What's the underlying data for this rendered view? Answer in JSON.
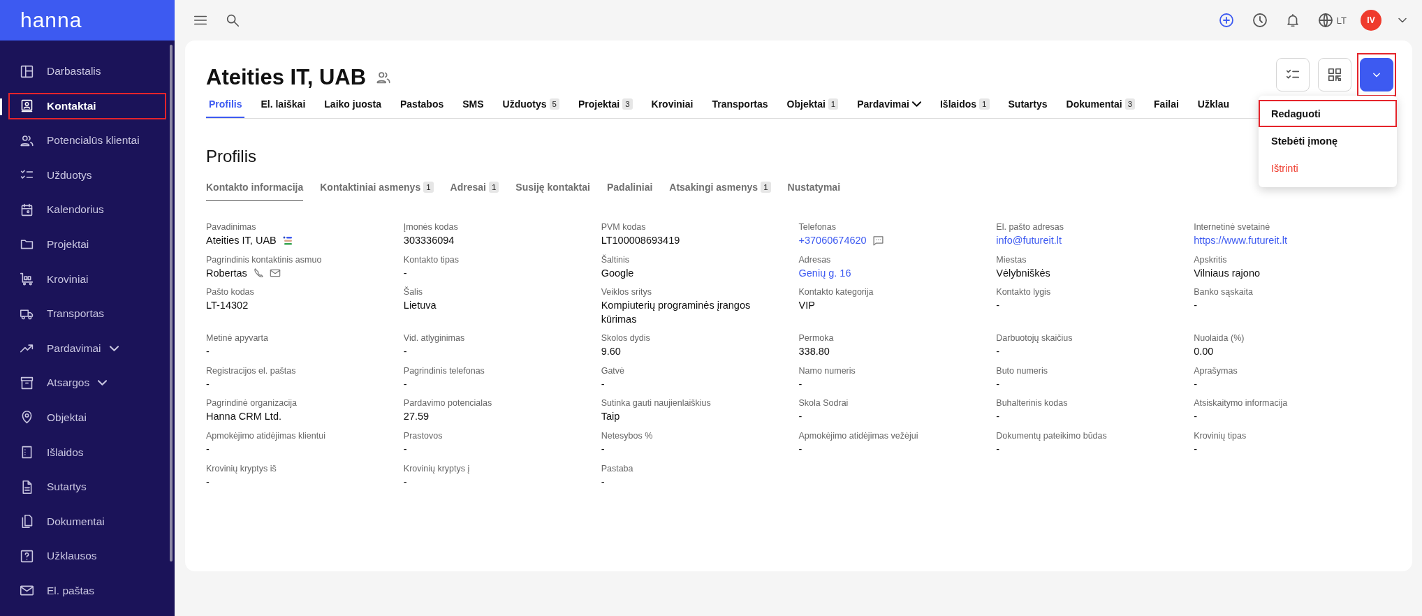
{
  "brand": "hanna",
  "sidebar": {
    "items": [
      {
        "label": "Darbastalis",
        "selected": false,
        "highlighted": false,
        "expandable": false
      },
      {
        "label": "Kontaktai",
        "selected": true,
        "highlighted": true,
        "expandable": false
      },
      {
        "label": "Potencialūs klientai",
        "selected": false,
        "highlighted": false,
        "expandable": false
      },
      {
        "label": "Užduotys",
        "selected": false,
        "highlighted": false,
        "expandable": false
      },
      {
        "label": "Kalendorius",
        "selected": false,
        "highlighted": false,
        "expandable": false
      },
      {
        "label": "Projektai",
        "selected": false,
        "highlighted": false,
        "expandable": false
      },
      {
        "label": "Kroviniai",
        "selected": false,
        "highlighted": false,
        "expandable": false
      },
      {
        "label": "Transportas",
        "selected": false,
        "highlighted": false,
        "expandable": false
      },
      {
        "label": "Pardavimai",
        "selected": false,
        "highlighted": false,
        "expandable": true
      },
      {
        "label": "Atsargos",
        "selected": false,
        "highlighted": false,
        "expandable": true
      },
      {
        "label": "Objektai",
        "selected": false,
        "highlighted": false,
        "expandable": false
      },
      {
        "label": "Išlaidos",
        "selected": false,
        "highlighted": false,
        "expandable": false
      },
      {
        "label": "Sutartys",
        "selected": false,
        "highlighted": false,
        "expandable": false
      },
      {
        "label": "Dokumentai",
        "selected": false,
        "highlighted": false,
        "expandable": false
      },
      {
        "label": "Užklausos",
        "selected": false,
        "highlighted": false,
        "expandable": false
      },
      {
        "label": "El. paštas",
        "selected": false,
        "highlighted": false,
        "expandable": false
      }
    ]
  },
  "topbar": {
    "language": "LT",
    "avatar": "IV"
  },
  "header": {
    "title": "Ateities IT, UAB",
    "action_highlighted": true,
    "menu": [
      {
        "label": "Redaguoti",
        "kind": "normal",
        "highlighted": true
      },
      {
        "label": "Stebėti įmonę",
        "kind": "normal",
        "highlighted": false
      },
      {
        "label": "Ištrinti",
        "kind": "danger",
        "highlighted": false
      }
    ]
  },
  "tabs": [
    {
      "label": "Profilis",
      "selected": true
    },
    {
      "label": "El. laiškai",
      "selected": false
    },
    {
      "label": "Laiko juosta",
      "selected": false
    },
    {
      "label": "Pastabos",
      "selected": false
    },
    {
      "label": "SMS",
      "selected": false
    },
    {
      "label": "Užduotys",
      "badge": "5",
      "selected": false
    },
    {
      "label": "Projektai",
      "badge": "3",
      "selected": false
    },
    {
      "label": "Kroviniai",
      "selected": false
    },
    {
      "label": "Transportas",
      "selected": false
    },
    {
      "label": "Objektai",
      "badge": "1",
      "selected": false
    },
    {
      "label": "Pardavimai",
      "dropdown": true,
      "selected": false
    },
    {
      "label": "Išlaidos",
      "badge": "1",
      "selected": false
    },
    {
      "label": "Sutartys",
      "selected": false
    },
    {
      "label": "Dokumentai",
      "badge": "3",
      "selected": false
    },
    {
      "label": "Failai",
      "selected": false
    },
    {
      "label": "Užklau",
      "selected": false
    }
  ],
  "section_title": "Profilis",
  "subtabs": [
    {
      "label": "Kontakto informacija",
      "selected": true
    },
    {
      "label": "Kontaktiniai asmenys",
      "badge": "1",
      "selected": false
    },
    {
      "label": "Adresai",
      "badge": "1",
      "selected": false
    },
    {
      "label": "Susiję kontaktai",
      "selected": false
    },
    {
      "label": "Padaliniai",
      "selected": false
    },
    {
      "label": "Atsakingi asmenys",
      "badge": "1",
      "selected": false
    },
    {
      "label": "Nustatymai",
      "selected": false
    }
  ],
  "fields": [
    {
      "label": "Pavadinimas",
      "value": "Ateities IT, UAB",
      "kind": "text"
    },
    {
      "label": "Įmonės kodas",
      "value": "303336094",
      "kind": "text"
    },
    {
      "label": "PVM kodas",
      "value": "LT100008693419",
      "kind": "text"
    },
    {
      "label": "Telefonas",
      "value": "+37060674620",
      "kind": "link"
    },
    {
      "label": "El. pašto adresas",
      "value": "info@futureit.lt",
      "kind": "link"
    },
    {
      "label": "Internetinė svetainė",
      "value": "https://www.futureit.lt",
      "kind": "link"
    },
    {
      "label": "Pagrindinis kontaktinis asmuo",
      "value": "Robertas",
      "kind": "text"
    },
    {
      "label": "Kontakto tipas",
      "value": "-",
      "kind": "text"
    },
    {
      "label": "Šaltinis",
      "value": "Google",
      "kind": "text"
    },
    {
      "label": "Adresas",
      "value": "Genių g. 16",
      "kind": "link"
    },
    {
      "label": "Miestas",
      "value": "Vėlybniškės",
      "kind": "text"
    },
    {
      "label": "Apskritis",
      "value": "Vilniaus rajono",
      "kind": "text"
    },
    {
      "label": "Pašto kodas",
      "value": "LT-14302",
      "kind": "text"
    },
    {
      "label": "Šalis",
      "value": "Lietuva",
      "kind": "text"
    },
    {
      "label": "Veiklos sritys",
      "value": "Kompiuterių programinės įrangos kūrimas",
      "kind": "text"
    },
    {
      "label": "Kontakto kategorija",
      "value": "VIP",
      "kind": "text"
    },
    {
      "label": "Kontakto lygis",
      "value": "-",
      "kind": "text"
    },
    {
      "label": "Banko sąskaita",
      "value": "-",
      "kind": "text"
    },
    {
      "label": "Metinė apyvarta",
      "value": "-",
      "kind": "text"
    },
    {
      "label": "Vid. atlyginimas",
      "value": "-",
      "kind": "text"
    },
    {
      "label": "Skolos dydis",
      "value": "9.60",
      "kind": "text"
    },
    {
      "label": "Permoka",
      "value": "338.80",
      "kind": "text"
    },
    {
      "label": "Darbuotojų skaičius",
      "value": "-",
      "kind": "text"
    },
    {
      "label": "Nuolaida (%)",
      "value": "0.00",
      "kind": "text"
    },
    {
      "label": "Registracijos el. paštas",
      "value": "-",
      "kind": "text"
    },
    {
      "label": "Pagrindinis telefonas",
      "value": "-",
      "kind": "text"
    },
    {
      "label": "Gatvė",
      "value": "-",
      "kind": "text"
    },
    {
      "label": "Namo numeris",
      "value": "-",
      "kind": "text"
    },
    {
      "label": "Buto numeris",
      "value": "-",
      "kind": "text"
    },
    {
      "label": "Aprašymas",
      "value": "-",
      "kind": "text"
    },
    {
      "label": "Pagrindinė organizacija",
      "value": "Hanna CRM Ltd.",
      "kind": "text"
    },
    {
      "label": "Pardavimo potencialas",
      "value": "27.59",
      "kind": "text"
    },
    {
      "label": "Sutinka gauti naujienlaiškius",
      "value": "Taip",
      "kind": "text"
    },
    {
      "label": "Skola Sodrai",
      "value": "-",
      "kind": "text"
    },
    {
      "label": "Buhalterinis kodas",
      "value": "-",
      "kind": "text"
    },
    {
      "label": "Atsiskaitymo informacija",
      "value": "-",
      "kind": "text"
    },
    {
      "label": "Apmokėjimo atidėjimas klientui",
      "value": "-",
      "kind": "text"
    },
    {
      "label": "Prastovos",
      "value": "-",
      "kind": "text"
    },
    {
      "label": "Netesybos %",
      "value": "-",
      "kind": "text"
    },
    {
      "label": "Apmokėjimo atidėjimas vežėjui",
      "value": "-",
      "kind": "text"
    },
    {
      "label": "Dokumentų pateikimo būdas",
      "value": "-",
      "kind": "text"
    },
    {
      "label": "Krovinių tipas",
      "value": "-",
      "kind": "text"
    },
    {
      "label": "Krovinių kryptys iš",
      "value": "-",
      "kind": "text"
    },
    {
      "label": "Krovinių kryptys į",
      "value": "-",
      "kind": "text"
    },
    {
      "label": "Pastaba",
      "value": "-",
      "kind": "text"
    }
  ]
}
